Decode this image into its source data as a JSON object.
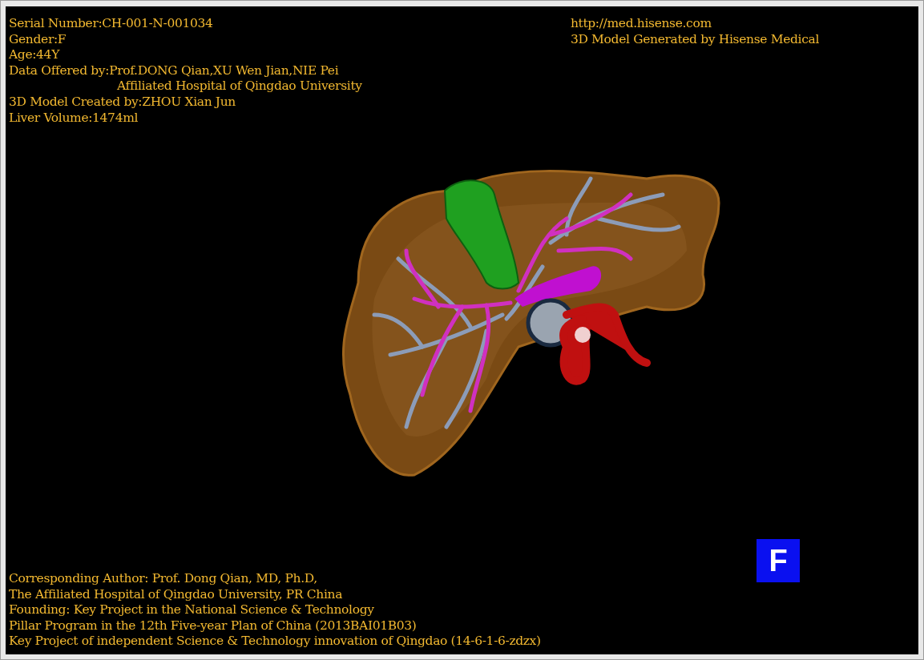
{
  "info_lines": [
    {
      "kind": "line",
      "text": "Serial Number:CH-001-N-001034"
    },
    {
      "kind": "line",
      "text": "Gender:F"
    },
    {
      "kind": "line",
      "text": "Age:44Y"
    },
    {
      "kind": "line",
      "text": "Data Offered by:Prof.DONG Qian,XU Wen Jian,NIE Pei"
    },
    {
      "kind": "continuation",
      "text": "Affiliated Hospital of Qingdao University"
    },
    {
      "kind": "line",
      "text": "3D Model Created by:ZHOU Xian Jun"
    },
    {
      "kind": "line",
      "text": "Liver Volume:1474ml"
    }
  ],
  "source_lines": [
    "http://med.hisense.com",
    "3D Model Generated by Hisense Medical"
  ],
  "credit_lines": [
    "Corresponding Author: Prof. Dong Qian, MD, Ph.D,",
    "The Affiliated Hospital of Qingdao University, PR China",
    "Founding: Key Project in the National Science & Technology",
    "Pillar Program in the 12th Five-year Plan of China (2013BAI01B03)",
    "Key Project of independent Science & Technology innovation of Qingdao (14-6-1-6-zdzx)"
  ],
  "orientation_badge": "F"
}
